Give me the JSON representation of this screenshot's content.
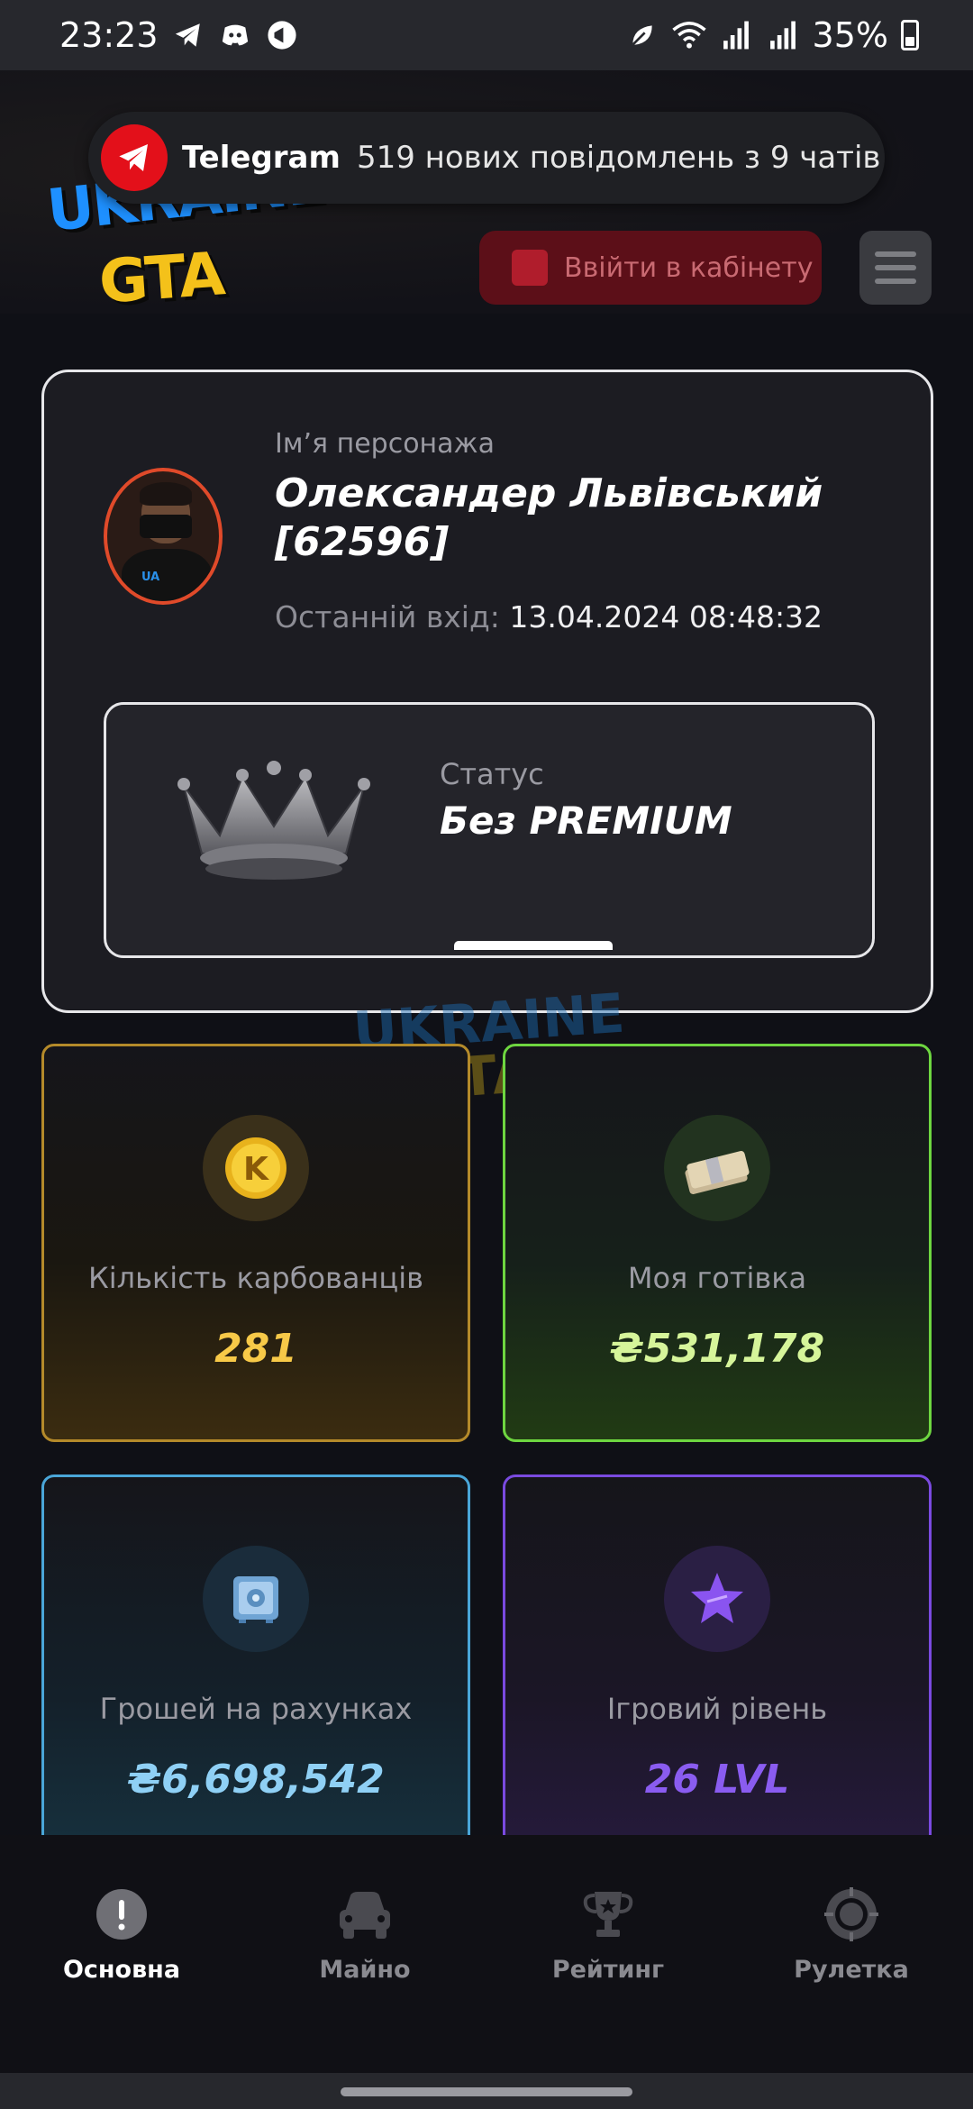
{
  "status_bar": {
    "time": "23:23",
    "battery": "35%",
    "icons": [
      "telegram-icon",
      "discord-icon",
      "megaphone-icon",
      "leaf-icon",
      "wifi-icon",
      "signal-icon",
      "signal-icon",
      "battery-icon"
    ]
  },
  "header": {
    "logo_line1": "UKRAINE",
    "logo_line2": "GTA",
    "login_button": "Ввійти в кабінету"
  },
  "notification": {
    "app": "Telegram",
    "text": "519 нових повідомлень з 9 чатів"
  },
  "profile": {
    "name_label": "Ім’я персонажа",
    "character_name": "Олександер Львівський [62596]",
    "last_login_label": "Останній вхід:",
    "last_login_value": "13.04.2024 08:48:32",
    "status_label": "Статус",
    "status_value": "Без PREMIUM"
  },
  "watermark": {
    "line1": "UKRAINE",
    "line2": "GTA"
  },
  "stats": {
    "karbovantsi": {
      "label": "Кількість карбованців",
      "value": "281",
      "icon": "coin-k-icon"
    },
    "cash": {
      "label": "Моя готівка",
      "value": "₴531,178",
      "icon": "money-stack-icon"
    },
    "accounts": {
      "label": "Грошей на рахунках",
      "value": "₴6,698,542",
      "icon": "safe-icon"
    },
    "level": {
      "label": "Ігровий рівень",
      "value": "26 LVL",
      "icon": "star-icon"
    }
  },
  "bottom_nav": [
    {
      "label": "Основна",
      "icon": "info-icon",
      "active": true
    },
    {
      "label": "Майно",
      "icon": "car-icon",
      "active": false
    },
    {
      "label": "Рейтинг",
      "icon": "trophy-icon",
      "active": false
    },
    {
      "label": "Рулетка",
      "icon": "roulette-icon",
      "active": false
    }
  ],
  "colors": {
    "gold": "#f7c948",
    "green": "#6ed640",
    "blue": "#4aa6d8",
    "purple": "#7a4ae0",
    "telegram_red": "#e3101a"
  }
}
